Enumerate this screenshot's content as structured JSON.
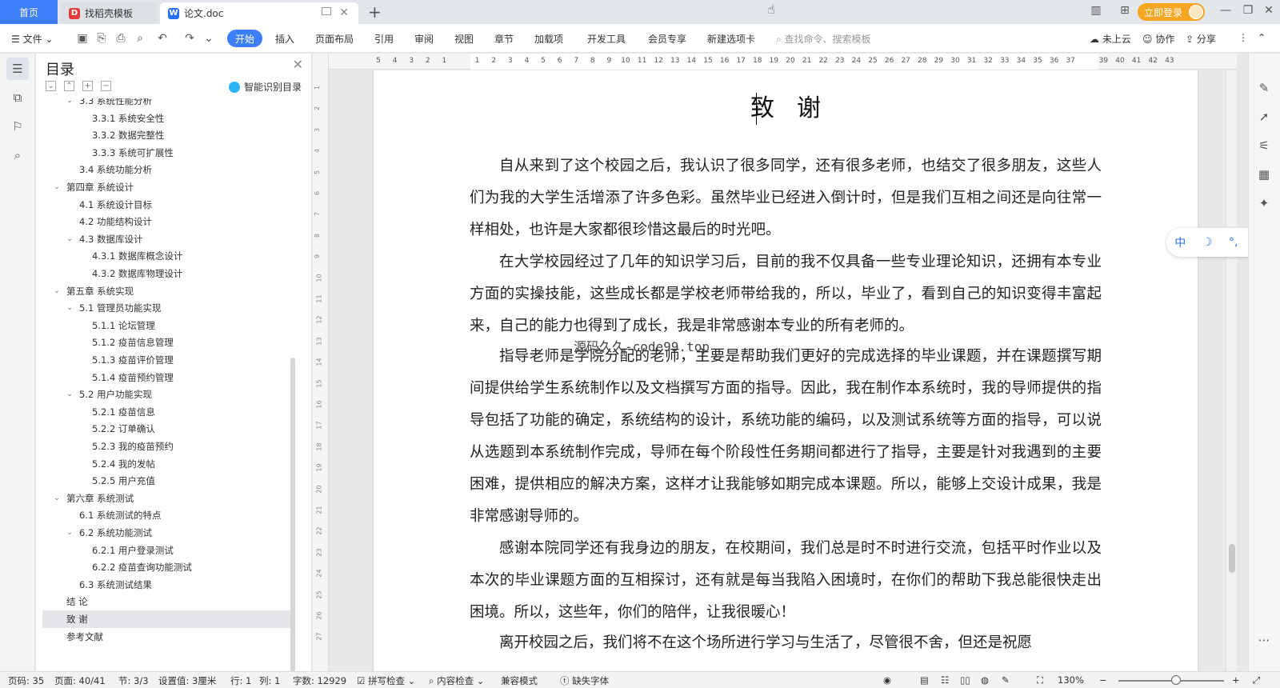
{
  "tabs": {
    "home": "首页",
    "t1": "找稻壳模板",
    "t2": "论文.doc"
  },
  "window": {
    "login_label": "立即登录"
  },
  "menu": {
    "file": "文件",
    "start": "开始",
    "items": [
      "插入",
      "页面布局",
      "引用",
      "审阅",
      "视图",
      "章节",
      "加载项",
      "开发工具",
      "会员专享",
      "新建选项卡"
    ],
    "search_placeholder": "查找命令、搜索模板",
    "cloud": "未上云",
    "collab": "协作",
    "share": "分享"
  },
  "toc": {
    "title": "目录",
    "smart": "智能识别目录",
    "rows": [
      {
        "text": "3.3 系统性能分析",
        "level": 2,
        "caret": true
      },
      {
        "text": "3.3.1 系统安全性",
        "level": 3
      },
      {
        "text": "3.3.2 数据完整性",
        "level": 3
      },
      {
        "text": "3.3.3 系统可扩展性",
        "level": 3
      },
      {
        "text": "3.4 系统功能分析",
        "level": 2
      },
      {
        "text": "第四章  系统设计",
        "level": 1,
        "caret": true
      },
      {
        "text": "4.1  系统设计目标",
        "level": 2
      },
      {
        "text": "4.2 功能结构设计",
        "level": 2
      },
      {
        "text": "4.3 数据库设计",
        "level": 2,
        "caret": true
      },
      {
        "text": "4.3.1  数据库概念设计",
        "level": 3
      },
      {
        "text": "4.3.2  数据库物理设计",
        "level": 3
      },
      {
        "text": "第五章  系统实现",
        "level": 1,
        "caret": true
      },
      {
        "text": "5.1 管理员功能实现",
        "level": 2,
        "caret": true
      },
      {
        "text": "5.1.1  论坛管理",
        "level": 3
      },
      {
        "text": "5.1.2  疫苗信息管理",
        "level": 3
      },
      {
        "text": "5.1.3  疫苗评价管理",
        "level": 3
      },
      {
        "text": "5.1.4  疫苗预约管理",
        "level": 3
      },
      {
        "text": "5.2 用户功能实现",
        "level": 2,
        "caret": true
      },
      {
        "text": "5.2.1  疫苗信息",
        "level": 3
      },
      {
        "text": "5.2.2  订单确认",
        "level": 3
      },
      {
        "text": "5.2.3  我的疫苗预约",
        "level": 3
      },
      {
        "text": "5.2.4  我的发帖",
        "level": 3
      },
      {
        "text": "5.2.5  用户充值",
        "level": 3
      },
      {
        "text": "第六章  系统测试",
        "level": 1,
        "caret": true
      },
      {
        "text": "6.1 系统测试的特点",
        "level": 2
      },
      {
        "text": "6.2  系统功能测试",
        "level": 2,
        "caret": true
      },
      {
        "text": "6.2.1  用户登录测试",
        "level": 3
      },
      {
        "text": "6.2.2  疫苗查询功能测试",
        "level": 3
      },
      {
        "text": "6.3  系统测试结果",
        "level": 2
      },
      {
        "text": "结    论",
        "level": 1
      },
      {
        "text": "致    谢",
        "level": 1,
        "selected": true
      },
      {
        "text": "参考文献",
        "level": 1
      }
    ]
  },
  "ruler": {
    "h_ticks": [
      "5",
      "4",
      "3",
      "2",
      "1",
      "",
      "1",
      "2",
      "3",
      "4",
      "5",
      "6",
      "7",
      "8",
      "9",
      "10",
      "11",
      "12",
      "13",
      "14",
      "15",
      "16",
      "17",
      "18",
      "19",
      "20",
      "21",
      "22",
      "23",
      "24",
      "25",
      "26",
      "27",
      "28",
      "29",
      "30",
      "31",
      "32",
      "33",
      "34",
      "35",
      "36",
      "37",
      "",
      "39",
      "40",
      "41",
      "42",
      "43"
    ],
    "v_ticks": [
      "1",
      "2",
      "3",
      "4",
      "5",
      "6",
      "7",
      "8",
      "9",
      "10",
      "11",
      "12",
      "13",
      "14",
      "15",
      "16",
      "17",
      "18",
      "19",
      "20",
      "21",
      "22",
      "23",
      "24",
      "25",
      "26",
      "27"
    ]
  },
  "document": {
    "heading": "致谢",
    "watermark": "源码久久-code99.top",
    "paragraphs": [
      "自从来到了这个校园之后，我认识了很多同学，还有很多老师，也结交了很多朋友，这些人们为我的大学生活增添了许多色彩。虽然毕业已经进入倒计时，但是我们互相之间还是向往常一样相处，也许是大家都很珍惜这最后的时光吧。",
      "在大学校园经过了几年的知识学习后，目前的我不仅具备一些专业理论知识，还拥有本专业方面的实操技能，这些成长都是学校老师带给我的，所以，毕业了，看到自己的知识变得丰富起来，自己的能力也得到了成长，我是非常感谢本专业的所有老师的。",
      "指导老师是学院分配的老师，主要是帮助我们更好的完成选择的毕业课题，并在课题撰写期间提供给学生系统制作以及文档撰写方面的指导。因此，我在制作本系统时，我的导师提供的指导包括了功能的确定，系统结构的设计，系统功能的编码，以及测试系统等方面的指导，可以说从选题到本系统制作完成，导师在每个阶段性任务期间都进行了指导，主要是针对我遇到的主要困难，提供相应的解决方案，这样才让我能够如期完成本课题。所以，能够上交设计成果，我是非常感谢导师的。",
      "感谢本院同学还有我身边的朋友，在校期间，我们总是时不时进行交流，包括平时作业以及本次的毕业课题方面的互相探讨，还有就是每当我陷入困境时，在你们的帮助下我总能很快走出困境。所以，这些年，你们的陪伴，让我很暖心！",
      "离开校园之后，我们将不在这个场所进行学习与生活了，尽管很不舍，但还是祝愿"
    ]
  },
  "ime": {
    "lang": "中",
    "moon": "☽",
    "punct": "°,",
    "arrow": "❯"
  },
  "status": {
    "page_code": "页码: 35",
    "page": "页面: 40/41",
    "section": "节: 3/3",
    "setting": "设置值: 3厘米",
    "row": "行: 1",
    "col": "列: 1",
    "words": "字数: 12929",
    "spell": "拼写检查",
    "content": "内容检查",
    "compat": "兼容模式",
    "missing_font": "缺失字体",
    "zoom": "130%"
  }
}
